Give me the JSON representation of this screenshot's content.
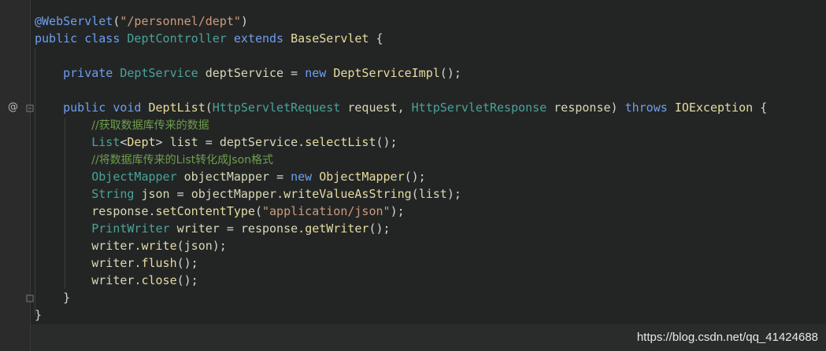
{
  "editor": {
    "gutter": {
      "override_marker": "@"
    },
    "lines": [
      {
        "id": "annotation",
        "parts": [
          {
            "t": "@WebServlet",
            "c": "kw"
          },
          {
            "t": "(",
            "c": "punct"
          },
          {
            "t": "\"/personnel/dept\"",
            "c": "str"
          },
          {
            "t": ")",
            "c": "punct"
          }
        ]
      },
      {
        "id": "class-decl",
        "parts": [
          {
            "t": "public ",
            "c": "kw"
          },
          {
            "t": "class ",
            "c": "kw"
          },
          {
            "t": "DeptController ",
            "c": "type"
          },
          {
            "t": "extends ",
            "c": "kw"
          },
          {
            "t": "BaseServlet ",
            "c": "method"
          },
          {
            "t": "{",
            "c": "punct"
          }
        ]
      },
      {
        "id": "blank-1",
        "parts": []
      },
      {
        "id": "field-decl",
        "parts": [
          {
            "t": "    private ",
            "c": "kw"
          },
          {
            "t": "DeptService ",
            "c": "type"
          },
          {
            "t": "deptService ",
            "c": "ident"
          },
          {
            "t": "= ",
            "c": "punct"
          },
          {
            "t": "new ",
            "c": "kw"
          },
          {
            "t": "DeptServiceImpl",
            "c": "method"
          },
          {
            "t": "();",
            "c": "punct"
          }
        ]
      },
      {
        "id": "blank-2",
        "parts": []
      },
      {
        "id": "method-decl",
        "parts": [
          {
            "t": "    public ",
            "c": "kw"
          },
          {
            "t": "void ",
            "c": "kw"
          },
          {
            "t": "DeptList",
            "c": "method"
          },
          {
            "t": "(",
            "c": "punct"
          },
          {
            "t": "HttpServletRequest ",
            "c": "type"
          },
          {
            "t": "request",
            "c": "ident"
          },
          {
            "t": ", ",
            "c": "punct"
          },
          {
            "t": "HttpServletResponse ",
            "c": "type"
          },
          {
            "t": "response",
            "c": "ident"
          },
          {
            "t": ") ",
            "c": "punct"
          },
          {
            "t": "throws ",
            "c": "kw"
          },
          {
            "t": "IOException ",
            "c": "method"
          },
          {
            "t": "{",
            "c": "punct"
          }
        ]
      },
      {
        "id": "comment-1",
        "parts": [
          {
            "t": "        ",
            "c": "punct"
          },
          {
            "t": "//获取数据库传来的数据",
            "c": "comment"
          }
        ]
      },
      {
        "id": "select-list",
        "parts": [
          {
            "t": "        List",
            "c": "type"
          },
          {
            "t": "<",
            "c": "punct"
          },
          {
            "t": "Dept",
            "c": "method"
          },
          {
            "t": "> ",
            "c": "punct"
          },
          {
            "t": "list ",
            "c": "ident"
          },
          {
            "t": "= ",
            "c": "punct"
          },
          {
            "t": "deptService",
            "c": "ident"
          },
          {
            "t": ".",
            "c": "punct"
          },
          {
            "t": "selectList",
            "c": "method"
          },
          {
            "t": "();",
            "c": "punct"
          }
        ]
      },
      {
        "id": "comment-2",
        "parts": [
          {
            "t": "        ",
            "c": "punct"
          },
          {
            "t": "//将数据库传来的List转化成Json格式",
            "c": "comment"
          }
        ]
      },
      {
        "id": "object-mapper",
        "parts": [
          {
            "t": "        ObjectMapper ",
            "c": "type"
          },
          {
            "t": "objectMapper ",
            "c": "ident"
          },
          {
            "t": "= ",
            "c": "punct"
          },
          {
            "t": "new ",
            "c": "kw"
          },
          {
            "t": "ObjectMapper",
            "c": "method"
          },
          {
            "t": "();",
            "c": "punct"
          }
        ]
      },
      {
        "id": "json-string",
        "parts": [
          {
            "t": "        String ",
            "c": "type"
          },
          {
            "t": "json ",
            "c": "ident"
          },
          {
            "t": "= ",
            "c": "punct"
          },
          {
            "t": "objectMapper",
            "c": "ident"
          },
          {
            "t": ".",
            "c": "punct"
          },
          {
            "t": "writeValueAsString",
            "c": "method"
          },
          {
            "t": "(",
            "c": "punct"
          },
          {
            "t": "list",
            "c": "ident"
          },
          {
            "t": ");",
            "c": "punct"
          }
        ]
      },
      {
        "id": "content-type",
        "parts": [
          {
            "t": "        response",
            "c": "ident"
          },
          {
            "t": ".",
            "c": "punct"
          },
          {
            "t": "setContentType",
            "c": "method"
          },
          {
            "t": "(",
            "c": "punct"
          },
          {
            "t": "\"application/json\"",
            "c": "str"
          },
          {
            "t": ");",
            "c": "punct"
          }
        ]
      },
      {
        "id": "print-writer",
        "parts": [
          {
            "t": "        PrintWriter ",
            "c": "type"
          },
          {
            "t": "writer ",
            "c": "ident"
          },
          {
            "t": "= ",
            "c": "punct"
          },
          {
            "t": "response",
            "c": "ident"
          },
          {
            "t": ".",
            "c": "punct"
          },
          {
            "t": "getWriter",
            "c": "method"
          },
          {
            "t": "();",
            "c": "punct"
          }
        ]
      },
      {
        "id": "write",
        "parts": [
          {
            "t": "        writer",
            "c": "ident"
          },
          {
            "t": ".",
            "c": "punct"
          },
          {
            "t": "write",
            "c": "method"
          },
          {
            "t": "(",
            "c": "punct"
          },
          {
            "t": "json",
            "c": "ident"
          },
          {
            "t": ");",
            "c": "punct"
          }
        ]
      },
      {
        "id": "flush",
        "parts": [
          {
            "t": "        writer",
            "c": "ident"
          },
          {
            "t": ".",
            "c": "punct"
          },
          {
            "t": "flush",
            "c": "method"
          },
          {
            "t": "();",
            "c": "punct"
          }
        ]
      },
      {
        "id": "close",
        "parts": [
          {
            "t": "        writer",
            "c": "ident"
          },
          {
            "t": ".",
            "c": "punct"
          },
          {
            "t": "close",
            "c": "method"
          },
          {
            "t": "();",
            "c": "punct"
          }
        ]
      },
      {
        "id": "method-close",
        "parts": [
          {
            "t": "    }",
            "c": "punct"
          }
        ]
      },
      {
        "id": "class-close",
        "parts": [
          {
            "t": "}",
            "c": "punct"
          }
        ]
      }
    ]
  },
  "watermark": {
    "text": "https://blog.csdn.net/qq_41424688"
  }
}
